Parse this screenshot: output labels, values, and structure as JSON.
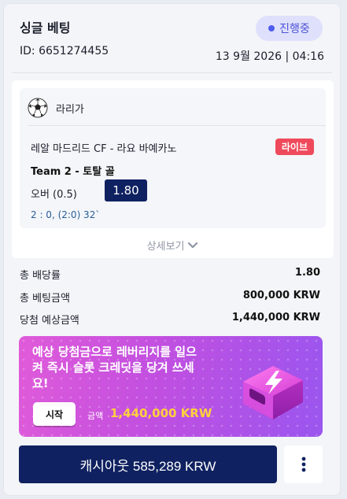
{
  "header": {
    "title": "싱글 베팅",
    "status": "진행중",
    "bet_id": "ID: 6651274455",
    "date": "13 9월 2026 | 04:16"
  },
  "selection": {
    "league_icon": "soccer-ball-icon",
    "league": "라리가",
    "match": "레알 마드리드 CF - 라요 바예카노",
    "live_badge": "라이브",
    "market": "Team 2 - 토탈 골",
    "pick": "오버 (0.5)",
    "odds": "1.80",
    "score": "2 : 0, (2:0) 32`",
    "details_link": "상세보기"
  },
  "summary": [
    {
      "label": "총 배당률",
      "value": "1.80"
    },
    {
      "label": "총 베팅금액",
      "value": "800,000 KRW"
    },
    {
      "label": "당첨 예상금액",
      "value": "1,440,000 KRW"
    }
  ],
  "promo": {
    "text": "예상 당첨금으로 레버리지를 일으켜 즉시 슬롯 크레딧을 당겨 쓰세요!",
    "start_button": "시작",
    "amount_label": "금액",
    "amount": "1,440,000 KRW",
    "icon": "lightning-bolt-icon"
  },
  "actions": {
    "cashout_label": "캐시아웃 585,289 KRW",
    "more_icon": "kebab-menu-icon"
  },
  "colors": {
    "primary": "#0f2160",
    "status_accent": "#4f5cf0",
    "live": "#ef4a5b",
    "promo_amount": "#ffd23c"
  }
}
